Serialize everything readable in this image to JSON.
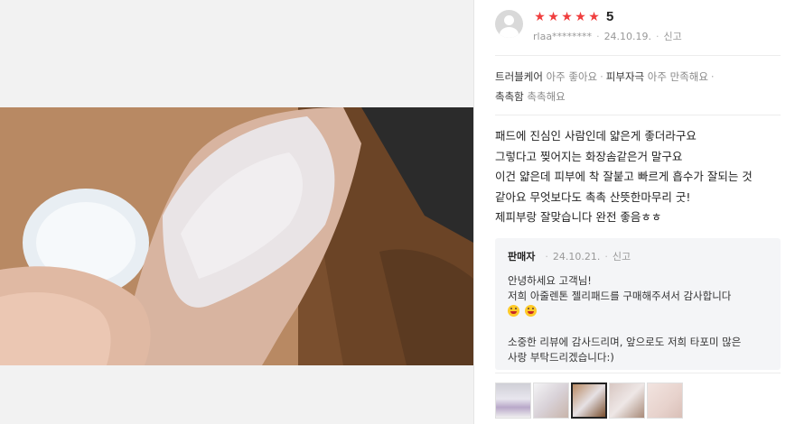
{
  "review": {
    "rating_score": "5",
    "stars": [
      "★",
      "★",
      "★",
      "★",
      "★"
    ],
    "author": "rlaa********",
    "date": "24.10.19.",
    "report_label": "신고",
    "separator": "·",
    "attributes": [
      {
        "key": "트러블케어",
        "value": "아주 좋아요"
      },
      {
        "key": "피부자극",
        "value": "아주 만족해요"
      },
      {
        "key": "촉촉함",
        "value": "촉촉해요"
      }
    ],
    "body_lines": [
      "패드에 진심인 사람인데 얇은게 좋더라구요",
      "그렇다고 찢어지는 화장솜같은거 말구요",
      "이건 얇은데 피부에 착 잘붙고 빠르게 흡수가 잘되는 것",
      "같아요 무엇보다도 촉촉 산뜻한마무리 굿!",
      "제피부랑 잘맞습니다 완전 좋음ㅎㅎ"
    ]
  },
  "seller_reply": {
    "label": "판매자",
    "date": "24.10.21.",
    "report_label": "신고",
    "lines": [
      "안녕하세요 고객님!",
      "저희 아줄렌톤 젤리패드를 구매해주셔서 감사합니다",
      "",
      "",
      "소중한 리뷰에 감사드리며, 앞으로도 저희 타포미 많은",
      "사랑 부탁드리겠습니다:)"
    ],
    "emoji_line_count": 2
  },
  "thumbnails": [
    {
      "name": "thumb-1",
      "active": false
    },
    {
      "name": "thumb-2",
      "active": false
    },
    {
      "name": "thumb-3",
      "active": true
    },
    {
      "name": "thumb-4",
      "active": false
    },
    {
      "name": "thumb-5",
      "active": false
    }
  ],
  "colors": {
    "star": "#f03e3e",
    "seller_box_bg": "#f4f5f7",
    "muted_text": "#999999"
  }
}
